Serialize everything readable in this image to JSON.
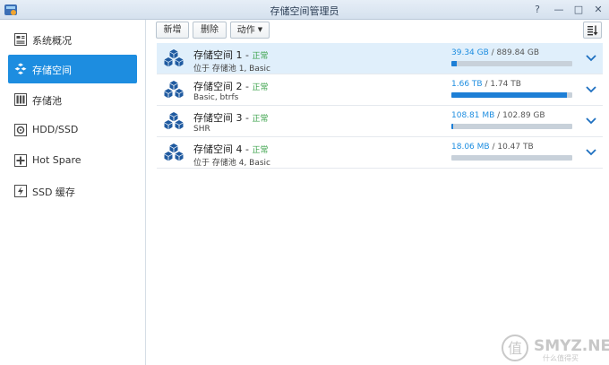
{
  "window": {
    "title": "存储空间管理员",
    "help_glyph": "?",
    "min_glyph": "—",
    "max_glyph": "□",
    "close_glyph": "✕"
  },
  "sidebar": {
    "items": [
      {
        "label": "系统概况",
        "icon": "overview-icon"
      },
      {
        "label": "存储空间",
        "icon": "volume-icon",
        "active": true
      },
      {
        "label": "存储池",
        "icon": "storage-pool-icon"
      },
      {
        "label": "HDD/SSD",
        "icon": "hdd-icon"
      },
      {
        "label": "Hot Spare",
        "icon": "hot-spare-icon"
      },
      {
        "label": "SSD 缓存",
        "icon": "ssd-cache-icon"
      }
    ]
  },
  "toolbar": {
    "new_label": "新增",
    "delete_label": "删除",
    "action_label": "动作",
    "action_caret": "▼"
  },
  "volumes": [
    {
      "name": "存储空间 1",
      "dash": " - ",
      "status": "正常",
      "desc": "位于 存储池 1, Basic",
      "used": "39.34 GB",
      "sep": " / ",
      "total": "889.84 GB",
      "usage_fraction": 0.044
    },
    {
      "name": "存储空间 2",
      "dash": " - ",
      "status": "正常",
      "desc": "Basic, btrfs",
      "used": "1.66 TB",
      "sep": " / ",
      "total": "1.74 TB",
      "usage_fraction": 0.954
    },
    {
      "name": "存储空间 3",
      "dash": " - ",
      "status": "正常",
      "desc": "SHR",
      "used": "108.81 MB",
      "sep": " / ",
      "total": "102.89 GB",
      "usage_fraction": 0.001
    },
    {
      "name": "存储空间 4",
      "dash": " - ",
      "status": "正常",
      "desc": "位于 存储池 4, Basic",
      "used": "18.06 MB",
      "sep": " / ",
      "total": "10.47 TB",
      "usage_fraction": 0.0
    }
  ],
  "watermark": {
    "text": "SMYZ.NET",
    "sub": "什么值得买"
  },
  "colors": {
    "accent": "#1d8de0",
    "status_ok": "#3aa24a",
    "bar_track": "#c8d1da",
    "bar_fill": "#1d7fd6",
    "selected_row": "#e0effb"
  }
}
